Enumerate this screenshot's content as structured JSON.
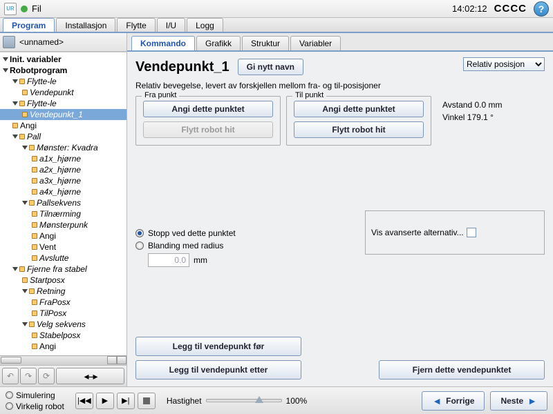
{
  "topbar": {
    "fil": "Fil",
    "clock": "14:02:12",
    "cccc": "CCCC"
  },
  "main_tabs": [
    "Program",
    "Installasjon",
    "Flytte",
    "I/U",
    "Logg"
  ],
  "main_tab_active": 0,
  "file_name": "<unnamed>",
  "tree": [
    {
      "t": "Init. variabler",
      "d": 0,
      "tri": 1,
      "bold": 1
    },
    {
      "t": "Robotprogram",
      "d": 0,
      "tri": 1,
      "bold": 1
    },
    {
      "t": "Flytte-le",
      "d": 1,
      "tri": 1,
      "a": 1,
      "it": 1
    },
    {
      "t": "Vendepunkt",
      "d": 2,
      "a": 1,
      "it": 1
    },
    {
      "t": "Flytte-le",
      "d": 1,
      "tri": 1,
      "a": 1,
      "it": 1
    },
    {
      "t": "Vendepunkt_1",
      "d": 2,
      "a": 1,
      "it": 1,
      "sel": 1
    },
    {
      "t": "Angi",
      "d": 1,
      "a": 1
    },
    {
      "t": "Pall",
      "d": 1,
      "tri": 1,
      "a": 1,
      "it": 1
    },
    {
      "t": "Mønster: Kvadra",
      "d": 2,
      "tri": 1,
      "a": 1,
      "it": 1
    },
    {
      "t": "a1x_hjørne",
      "d": 3,
      "a": 1,
      "it": 1
    },
    {
      "t": "a2x_hjørne",
      "d": 3,
      "a": 1,
      "it": 1
    },
    {
      "t": "a3x_hjørne",
      "d": 3,
      "a": 1,
      "it": 1
    },
    {
      "t": "a4x_hjørne",
      "d": 3,
      "a": 1,
      "it": 1
    },
    {
      "t": "Pallsekvens",
      "d": 2,
      "tri": 1,
      "a": 1,
      "it": 1
    },
    {
      "t": "Tilnærming",
      "d": 3,
      "a": 1,
      "it": 1
    },
    {
      "t": "Mønsterpunk",
      "d": 3,
      "a": 1,
      "it": 1
    },
    {
      "t": "Angi",
      "d": 3,
      "a": 1
    },
    {
      "t": "Vent",
      "d": 3,
      "a": 1
    },
    {
      "t": "Avslutte",
      "d": 3,
      "a": 1,
      "it": 1
    },
    {
      "t": "Fjerne fra stabel",
      "d": 1,
      "tri": 1,
      "a": 1,
      "it": 1
    },
    {
      "t": "Startposx",
      "d": 2,
      "a": 1,
      "it": 1
    },
    {
      "t": "Retning",
      "d": 2,
      "tri": 1,
      "a": 1,
      "it": 1
    },
    {
      "t": "FraPosx",
      "d": 3,
      "a": 1,
      "it": 1
    },
    {
      "t": "TilPosx",
      "d": 3,
      "a": 1,
      "it": 1
    },
    {
      "t": "Velg sekvens",
      "d": 2,
      "tri": 1,
      "a": 1,
      "it": 1
    },
    {
      "t": "Stabelposx",
      "d": 3,
      "a": 1,
      "it": 1
    },
    {
      "t": "Angi",
      "d": 3,
      "a": 1
    }
  ],
  "sub_tabs": [
    "Kommando",
    "Grafikk",
    "Struktur",
    "Variabler"
  ],
  "sub_tab_active": 0,
  "panel": {
    "title": "Vendepunkt_1",
    "rename": "Gi nytt navn",
    "relpos": "Relativ posisjon",
    "desc": "Relativ bevegelse, levert av forskjellen mellom fra- og til-posisjoner",
    "from_legend": "Fra punkt",
    "to_legend": "Til punkt",
    "set_point": "Angi dette punktet",
    "move_here": "Flytt robot hit",
    "dist": "Avstand 0.0 mm",
    "angle": "Vinkel 179.1 °",
    "adv": "Vis avanserte alternativ...",
    "stop_at": "Stopp ved dette punktet",
    "blend": "Blanding med radius",
    "blend_val": "0.0",
    "blend_unit": "mm",
    "add_before": "Legg til vendepunkt før",
    "add_after": "Legg til vendepunkt etter",
    "remove": "Fjern dette vendepunktet"
  },
  "footer": {
    "sim": "Simulering",
    "real": "Virkelig robot",
    "speed_label": "Hastighet",
    "speed_val": "100%",
    "prev": "Forrige",
    "next": "Neste"
  }
}
